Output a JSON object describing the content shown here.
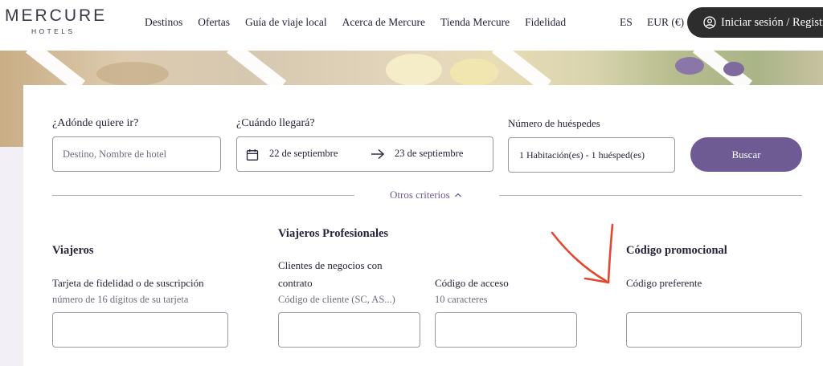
{
  "brand": {
    "name": "MERCURE",
    "sub": "HOTELS"
  },
  "nav": {
    "items": [
      "Destinos",
      "Ofertas",
      "Guía de viaje local",
      "Acerca de Mercure",
      "Tienda Mercure",
      "Fidelidad"
    ],
    "language": "ES",
    "currency": "EUR (€)",
    "login_label": "Iniciar sesión / Registrarse"
  },
  "search": {
    "destination_label": "¿Adónde quiere ir?",
    "destination_placeholder": "Destino, Nombre de hotel",
    "dates_label": "¿Cuándo llegará?",
    "checkin": "22 de septiembre",
    "checkout": "23 de septiembre",
    "guests_label": "Número de huéspedes",
    "guests_value": "1 Habitación(es) - 1 huésped(es)",
    "search_button": "Buscar",
    "more_criteria": "Otros criterios"
  },
  "criteria": {
    "travellers": {
      "title": "Viajeros",
      "loyalty_label": "Tarjeta de fidelidad o de suscripción",
      "loyalty_hint": "número de 16 dígitos de su tarjeta"
    },
    "professional": {
      "title": "Viajeros Profesionales",
      "contract_label_1": "Clientes de negocios con",
      "contract_label_2": "contrato",
      "contract_hint": "Código de cliente (SC, AS...)",
      "access_label": "Código de acceso",
      "access_hint": "10 caracteres"
    },
    "promo": {
      "title": "Código promocional",
      "preferred_label": "Código preferente"
    }
  },
  "colors": {
    "accent": "#6e5b93",
    "annotation": "#e2472f",
    "login_bg": "#2d2d2d"
  }
}
